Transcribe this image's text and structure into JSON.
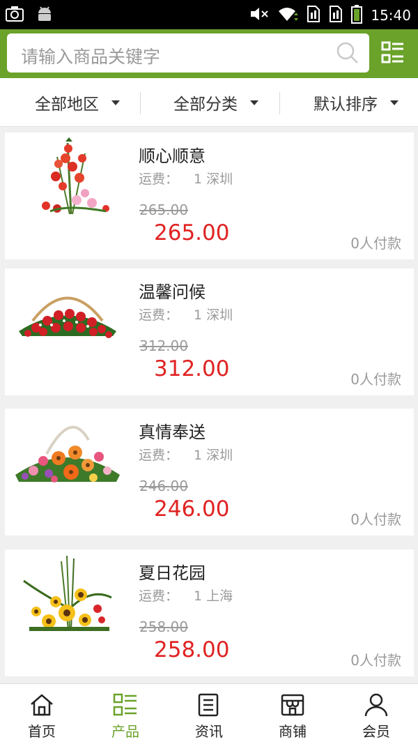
{
  "status_bar": {
    "time": "15:40",
    "icons": [
      "camera-icon",
      "android-icon",
      "mute-icon",
      "wifi-icon",
      "sim1-icon",
      "sim2-icon",
      "battery-icon"
    ]
  },
  "search": {
    "placeholder": "请输入商品关键字"
  },
  "filters": [
    {
      "label": "全部地区"
    },
    {
      "label": "全部分类"
    },
    {
      "label": "默认排序"
    }
  ],
  "products": [
    {
      "name": "顺心顺意",
      "shipping_label": "运费：",
      "shipping_value": "1 深圳",
      "old_price": "265.00",
      "price": "265.00",
      "paid": "0人付款",
      "image": "red-gladiolus-bouquet"
    },
    {
      "name": "温馨问候",
      "shipping_label": "运费：",
      "shipping_value": "1 深圳",
      "old_price": "312.00",
      "price": "312.00",
      "paid": "0人付款",
      "image": "red-carnation-basket"
    },
    {
      "name": "真情奉送",
      "shipping_label": "运费：",
      "shipping_value": "1 深圳",
      "old_price": "246.00",
      "price": "246.00",
      "paid": "0人付款",
      "image": "orange-gerbera-basket"
    },
    {
      "name": "夏日花园",
      "shipping_label": "运费：",
      "shipping_value": "1 上海",
      "old_price": "258.00",
      "price": "258.00",
      "paid": "0人付款",
      "image": "sunflower-arrangement"
    }
  ],
  "tabs": [
    {
      "label": "首页",
      "icon": "home-icon",
      "active": false
    },
    {
      "label": "产品",
      "icon": "product-list-icon",
      "active": true
    },
    {
      "label": "资讯",
      "icon": "news-icon",
      "active": false
    },
    {
      "label": "商铺",
      "icon": "shop-icon",
      "active": false
    },
    {
      "label": "会员",
      "icon": "member-icon",
      "active": false
    }
  ],
  "colors": {
    "brand_green": "#6aa22a",
    "price_red": "#e02222",
    "muted_gray": "#9a9a9a"
  }
}
